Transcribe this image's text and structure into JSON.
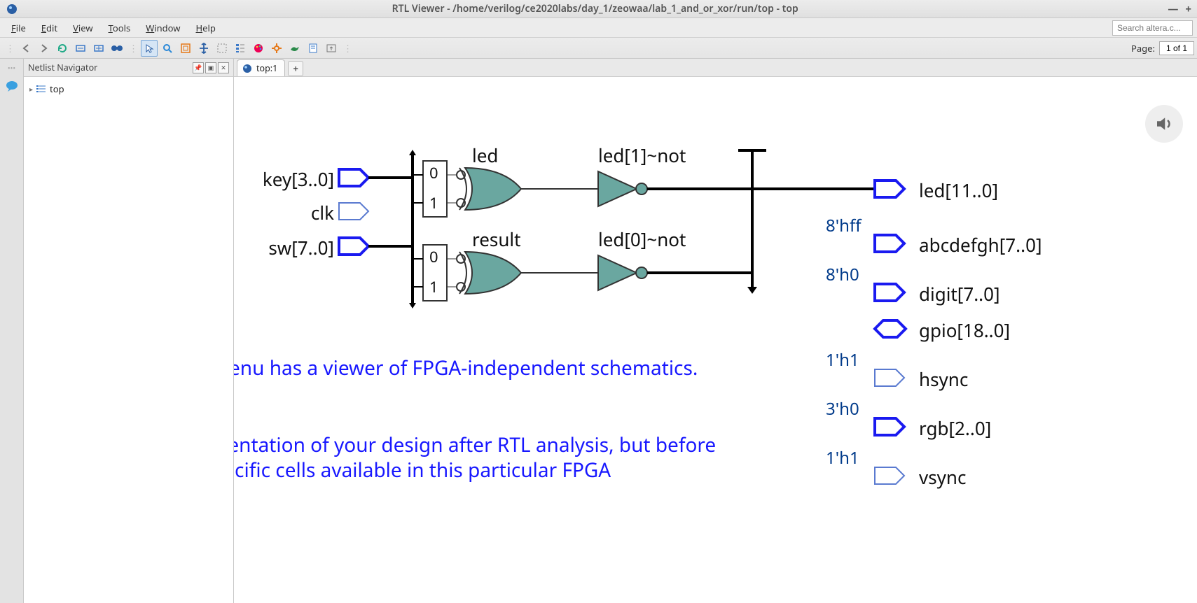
{
  "window": {
    "title": "RTL Viewer - /home/verilog/ce2020labs/day_1/zeowaa/lab_1_and_or_xor/run/top - top",
    "minimize": "—",
    "maximize": "+"
  },
  "menu": {
    "file": "File",
    "edit": "Edit",
    "view": "View",
    "tools": "Tools",
    "window": "Window",
    "help": "Help"
  },
  "search": {
    "placeholder": "Search altera.c..."
  },
  "toolbar": {
    "page_label": "Page:",
    "page_value": "1 of 1"
  },
  "navigator": {
    "title": "Netlist Navigator",
    "root": "top"
  },
  "tabs": {
    "t0": "top:1"
  },
  "schematic": {
    "inputs": {
      "key": "key[3..0]",
      "clk": "clk",
      "sw": "sw[7..0]"
    },
    "gates": {
      "led": "led",
      "result": "result",
      "not1": "led[1]~not",
      "not0": "led[0]~not"
    },
    "mux": {
      "i0a": "0",
      "i1a": "1",
      "i0b": "0",
      "i1b": "1"
    },
    "outputs": {
      "led": "led[11..0]",
      "abcdefgh": "abcdefgh[7..0]",
      "digit": "digit[7..0]",
      "gpio": "gpio[18..0]",
      "hsync": "hsync",
      "rgb": "rgb[2..0]",
      "vsync": "vsync"
    },
    "consts": {
      "c8hff": "8'hff",
      "c8h0": "8'h0",
      "c1h1a": "1'h1",
      "c3h0": "3'h0",
      "c1h1b": "1'h1"
    }
  },
  "annotation": {
    "p1": "The task window menu has a viewer of FPGA-independent schematics.",
    "p2": "It shows the representation of your design after RTL analysis, but before mapping RTL to specific cells available in this particular FPGA"
  }
}
